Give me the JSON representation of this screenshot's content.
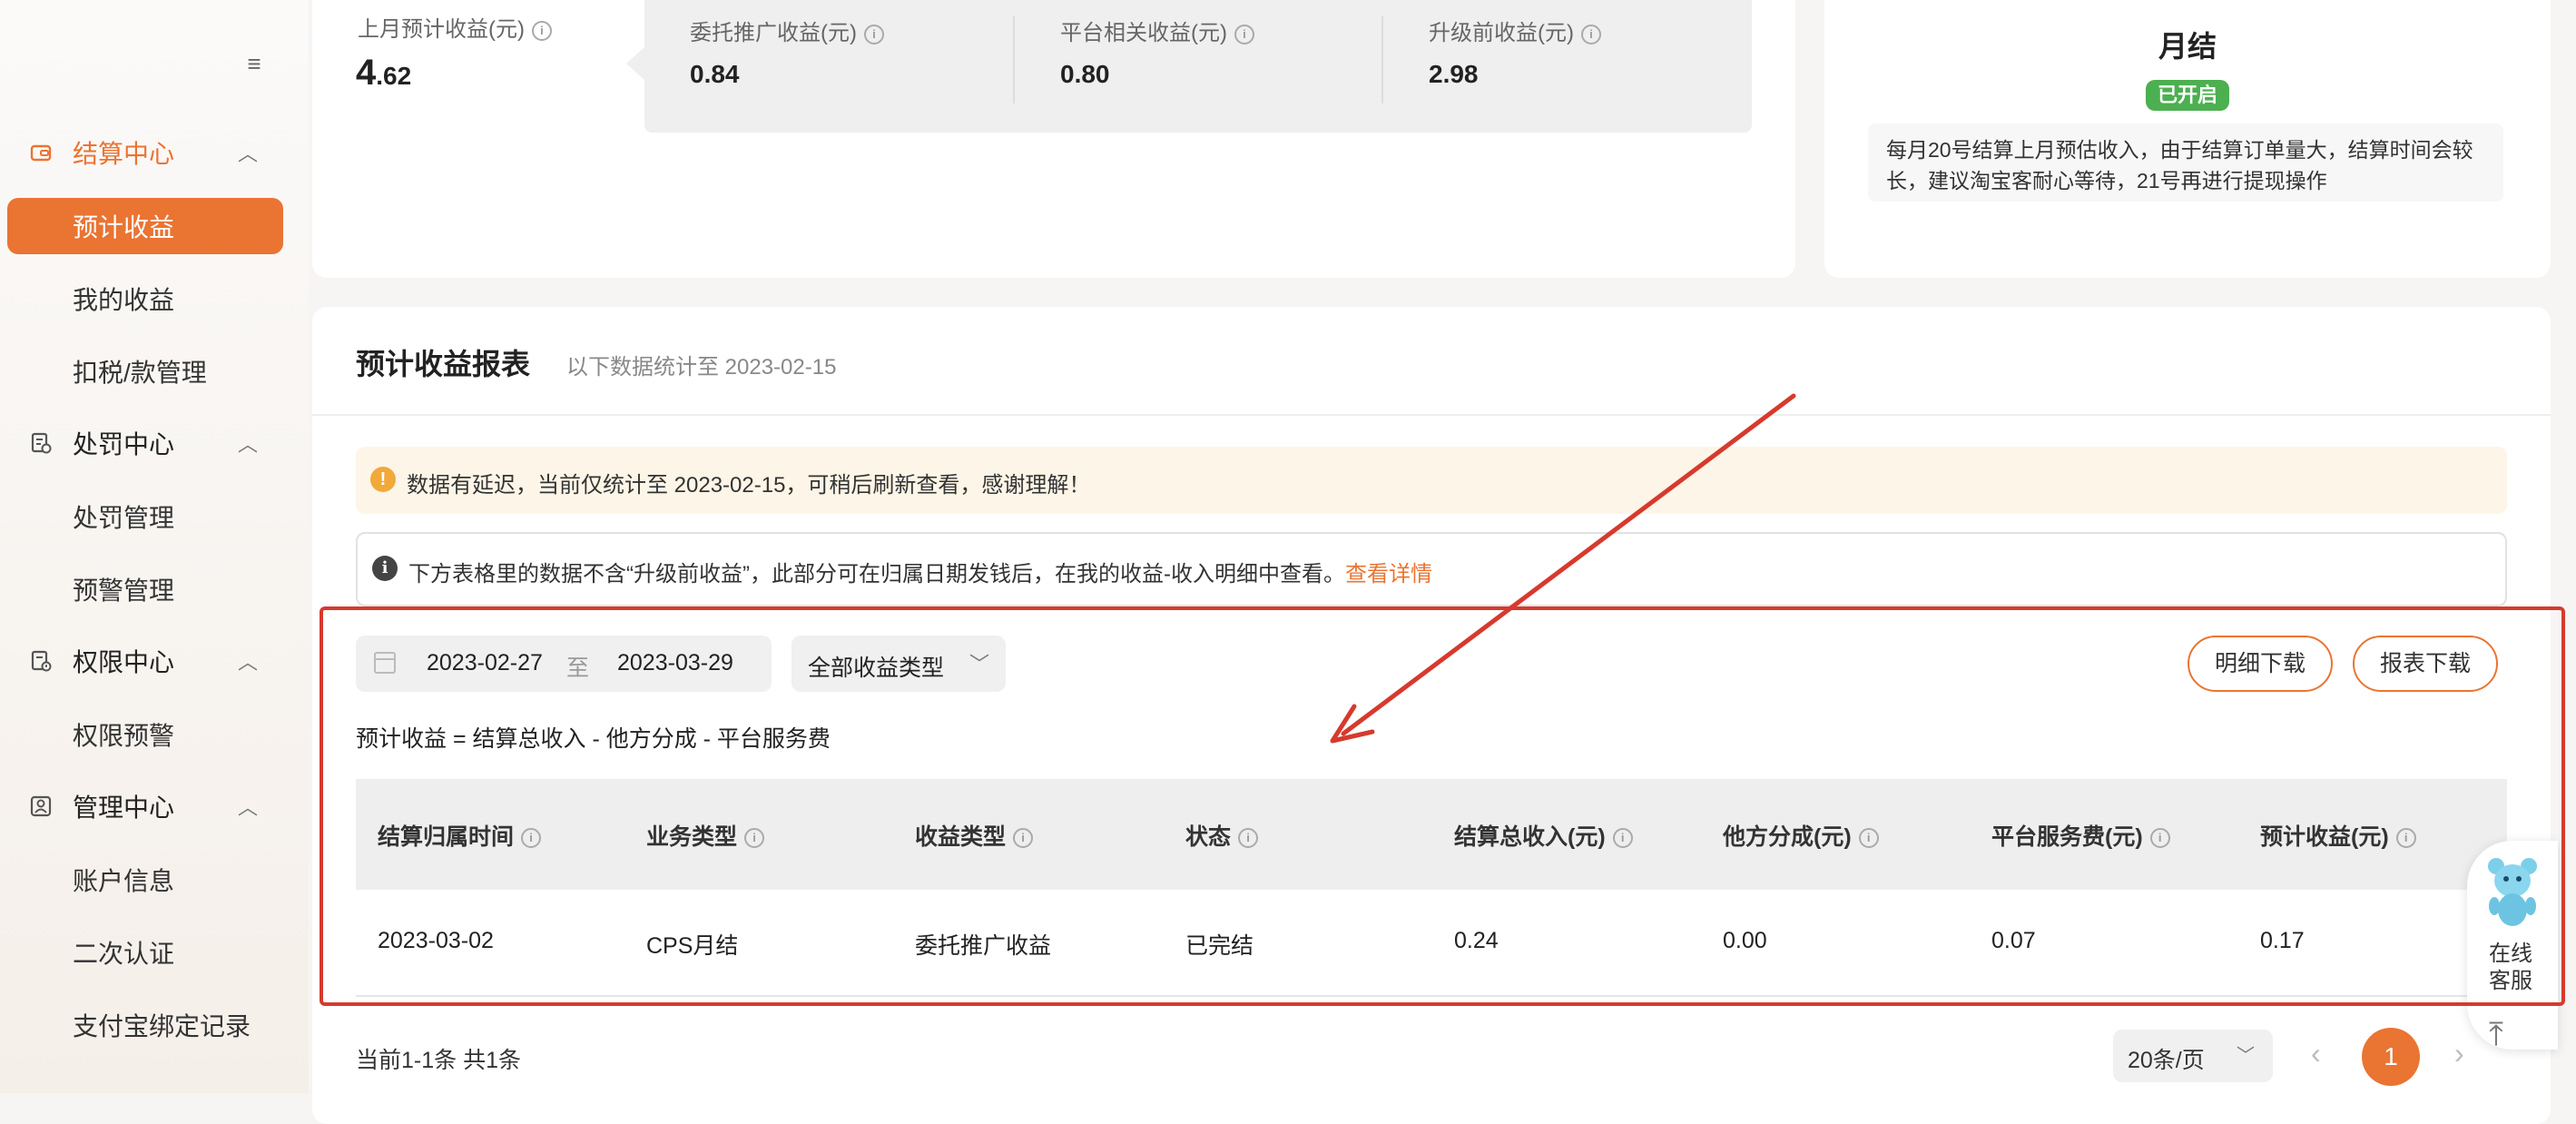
{
  "sidebar": {
    "groups": [
      {
        "label": "结算中心",
        "icon": "wallet-icon",
        "items": [
          "预计收益",
          "我的收益",
          "扣税/款管理"
        ]
      },
      {
        "label": "处罚中心",
        "icon": "penalty-doc-icon",
        "items": [
          "处罚管理",
          "预警管理"
        ]
      },
      {
        "label": "权限中心",
        "icon": "permission-doc-icon",
        "items": [
          "权限预警"
        ]
      },
      {
        "label": "管理中心",
        "icon": "user-card-icon",
        "items": [
          "账户信息",
          "二次认证",
          "支付宝绑定记录"
        ]
      }
    ]
  },
  "summary": {
    "last_month_label": "上月预计收益(元)",
    "last_month_value_int": "4",
    "last_month_value_dec": ".62",
    "items": [
      {
        "label": "委托推广收益(元)",
        "value": "0.84"
      },
      {
        "label": "平台相关收益(元)",
        "value": "0.80"
      },
      {
        "label": "升级前收益(元)",
        "value": "2.98"
      }
    ]
  },
  "settlement": {
    "title": "月结",
    "badge": "已开启",
    "desc": "每月20号结算上月预估收入，由于结算订单量大，结算时间会较长，建议淘宝客耐心等待，21号再进行提现操作"
  },
  "report": {
    "title": "预计收益报表",
    "subtitle": "以下数据统计至 2023-02-15",
    "warning": "数据有延迟，当前仅统计至 2023-02-15，可稍后刷新查看，感谢理解！",
    "note": "下方表格里的数据不含“升级前收益”，此部分可在归属日期发钱后，在我的收益-收入明细中查看。",
    "note_link": "查看详情",
    "date_start": "2023-02-27",
    "date_sep": "至",
    "date_end": "2023-03-29",
    "type_select": "全部收益类型",
    "btn_detail": "明细下载",
    "btn_report": "报表下载",
    "formula": "预计收益 = 结算总收入 - 他方分成 - 平台服务费",
    "columns": [
      "结算归属时间",
      "业务类型",
      "收益类型",
      "状态",
      "结算总收入(元)",
      "他方分成(元)",
      "平台服务费(元)",
      "预计收益(元)"
    ],
    "rows": [
      [
        "2023-03-02",
        "CPS月结",
        "委托推广收益",
        "已完结",
        "0.24",
        "0.00",
        "0.07",
        "0.17"
      ]
    ],
    "footer_count": "当前1-1条 共1条",
    "page_size": "20条/页",
    "current_page": "1"
  },
  "service": {
    "label_line1": "在线",
    "label_line2": "客服"
  },
  "colors": {
    "accent": "#ea7432",
    "annotation": "#d63a2e",
    "badge_green": "#4caf50"
  }
}
